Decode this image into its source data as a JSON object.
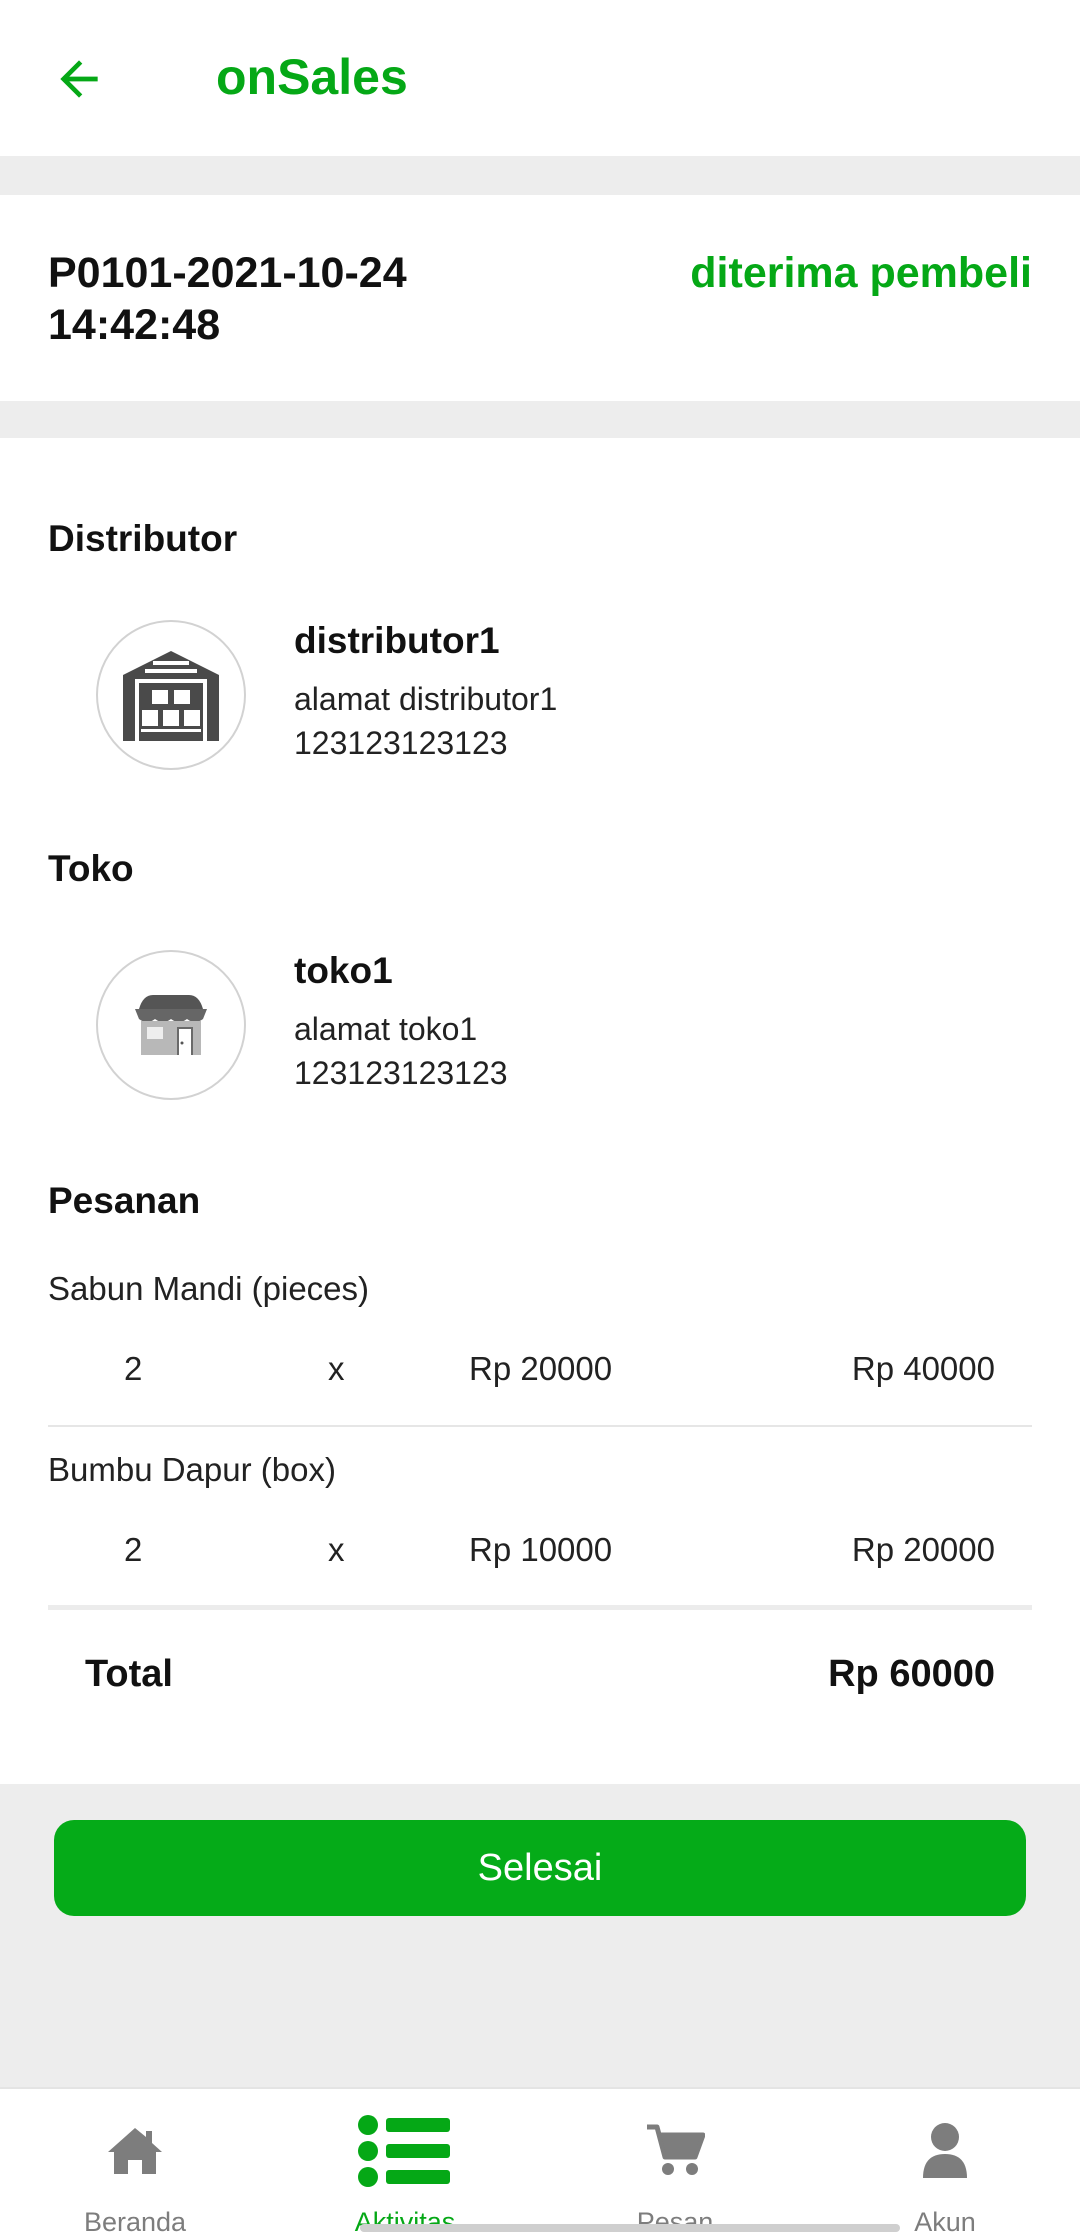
{
  "appbar": {
    "title": "onSales",
    "back_icon": "arrow-left-icon"
  },
  "order": {
    "id": "P0101-2021-10-24 14:42:48",
    "status": "diterima pembeli"
  },
  "distributor": {
    "section_title": "Distributor",
    "name": "distributor1",
    "address": "alamat distributor1",
    "phone": "123123123123",
    "icon": "warehouse-icon"
  },
  "store": {
    "section_title": "Toko",
    "name": "toko1",
    "address": "alamat toko1",
    "phone": "123123123123",
    "icon": "store-icon"
  },
  "order_items": {
    "section_title": "Pesanan",
    "items": [
      {
        "name": "Sabun Mandi (pieces)",
        "qty": "2",
        "times": "x",
        "price": "Rp 20000",
        "subtotal": "Rp 40000"
      },
      {
        "name": "Bumbu Dapur (box)",
        "qty": "2",
        "times": "x",
        "price": "Rp 10000",
        "subtotal": "Rp 20000"
      }
    ],
    "total_label": "Total",
    "total_value": "Rp 60000"
  },
  "action": {
    "done_label": "Selesai"
  },
  "bottom_nav": {
    "items": [
      {
        "label": "Beranda",
        "icon": "home-icon",
        "active": false
      },
      {
        "label": "Aktivitas",
        "icon": "list-icon",
        "active": true
      },
      {
        "label": "Pesan",
        "icon": "cart-icon",
        "active": false
      },
      {
        "label": "Akun",
        "icon": "user-icon",
        "active": false
      }
    ]
  },
  "colors": {
    "accent": "#05a816",
    "button": "#05ab18",
    "inactive": "#7d7d7d",
    "background": "#ededed"
  }
}
